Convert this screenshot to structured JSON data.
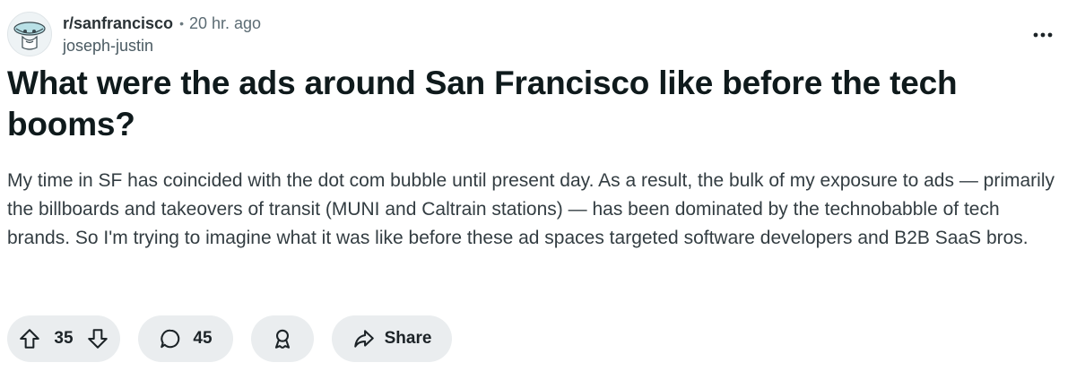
{
  "post": {
    "subreddit": "r/sanfrancisco",
    "separator": "•",
    "time_ago": "20 hr. ago",
    "author": "joseph-justin",
    "title": "What were the ads around San Francisco like before the tech booms?",
    "body": "My time in SF has coincided with the dot com bubble until present day. As a result, the bulk of my exposure to ads — primarily the billboards and takeovers of transit (MUNI and Caltrain stations) — has been dominated by the technobabble of tech brands. So I'm trying to imagine what it was like before these ad spaces targeted software developers and B2B SaaS bros."
  },
  "actions": {
    "votes": "35",
    "comments": "45",
    "share_label": "Share"
  },
  "icons": {
    "avatar": "subreddit-avatar-icon",
    "more": "more-options-icon",
    "upvote": "upvote-arrow-icon",
    "downvote": "downvote-arrow-icon",
    "comment": "comment-bubble-icon",
    "award": "award-icon",
    "share": "share-arrow-icon"
  },
  "colors": {
    "pill_background": "#eaedef",
    "title_text": "#0f1a1c",
    "body_text": "#333d42"
  }
}
